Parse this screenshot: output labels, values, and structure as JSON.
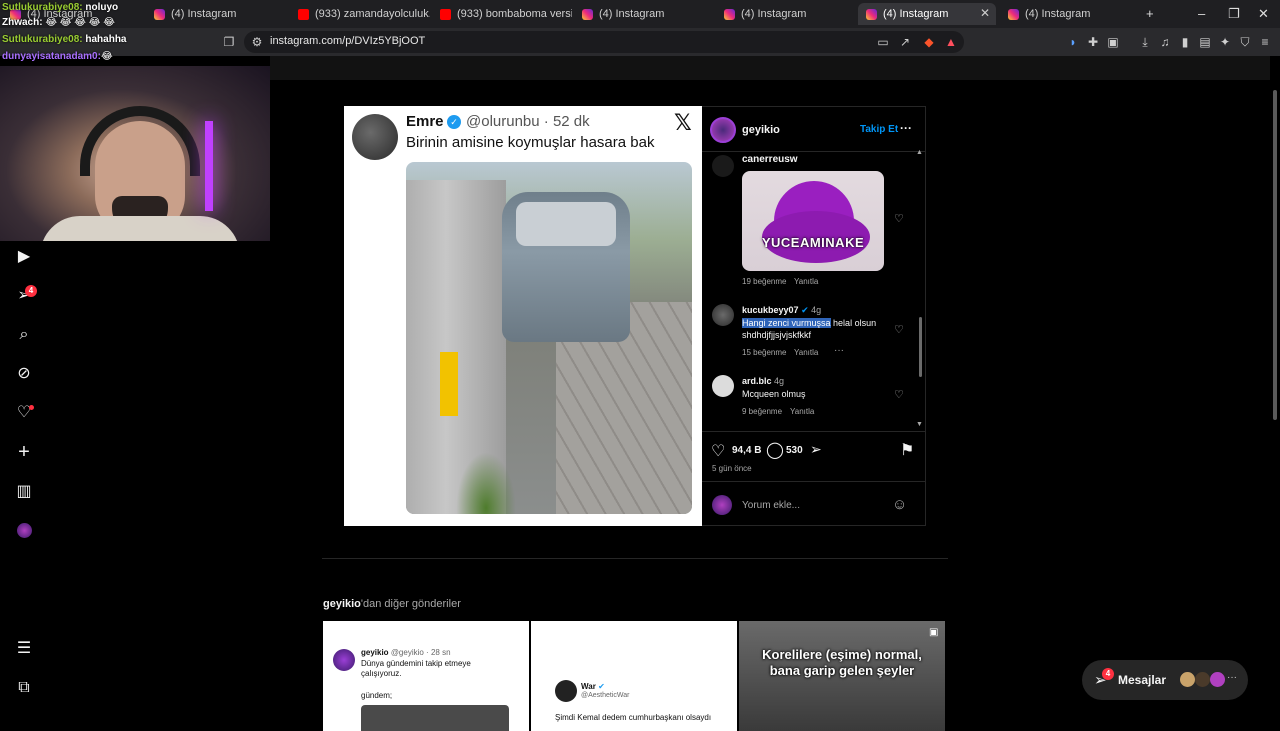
{
  "browser": {
    "tabs": [
      {
        "title": "(4) Instagram",
        "favicon": "instagram",
        "active": false
      },
      {
        "title": "(4) Instagram",
        "favicon": "instagram",
        "active": false
      },
      {
        "title": "(933) zamandayolculuk.mp3 - Y",
        "favicon": "youtube",
        "active": false
      },
      {
        "title": "(933) bombaboma versiyon 2.n",
        "favicon": "youtube",
        "active": false
      },
      {
        "title": "(4) Instagram",
        "favicon": "instagram",
        "active": false
      },
      {
        "title": "(4) Instagram",
        "favicon": "instagram",
        "active": false
      },
      {
        "title": "(4) Instagram",
        "favicon": "instagram",
        "active": true
      },
      {
        "title": "(4) Instagram",
        "favicon": "instagram",
        "active": false
      }
    ],
    "new_tab_symbol": "+",
    "url": "instagram.com/p/DVIz5YBjOOT"
  },
  "stream_chat": [
    {
      "user": "Sutlukurabiye08:",
      "message": "noluyo"
    },
    {
      "user": "Zhwach:",
      "message": "😂 😂 😂 😂 😂"
    },
    {
      "user": "Sutlukurabiye08:",
      "message": "hahahha"
    },
    {
      "user": "dunyayisatanadam0:",
      "message": "😂"
    }
  ],
  "nav": {
    "notifications_badge": "4"
  },
  "post": {
    "tweet": {
      "name": "Emre",
      "handle": "@olurunbu · 52 dk",
      "text": "Birinin amisine koymuşlar hasara bak",
      "x_logo": "𝕏"
    },
    "author": "geyikio",
    "follow_label": "Takip Et",
    "more_symbol": "···",
    "comments": [
      {
        "user": "canerreusw",
        "image_caption": "YUCEAMINAKE",
        "likes": "19 beğenme",
        "reply": "Yanıtla"
      },
      {
        "user": "kucukbeyy07",
        "time": "4g",
        "text_selected": "Hangi zenci vurmuşsa",
        "text_rest": " helal olsun",
        "text_line2": "shdhdjfjjsjvjskfkkf",
        "likes": "15 beğenme",
        "reply": "Yanıtla",
        "more": "···"
      },
      {
        "user": "ard.blc",
        "time": "4g",
        "text": "Mcqueen olmuş",
        "likes": "9 beğenme",
        "reply": "Yanıtla"
      }
    ],
    "like_count": "94,4 B",
    "comment_count": "530",
    "posted": "5 gün önce",
    "comment_placeholder": "Yorum ekle..."
  },
  "more_posts": {
    "title_user": "geyikio",
    "title_rest": "'dan diğer gönderiler",
    "thumbs": [
      {
        "name": "geyikio",
        "handle": "@geyikio · 28 sn",
        "line1": "Dünya gündemini takip etmeye",
        "line2": "çalışıyoruz.",
        "line3": "gündem;"
      },
      {
        "name": "War",
        "handle": "@AestheticWar",
        "line1": "Şimdi Kemal dedem cumhurbaşkanı olsaydı"
      },
      {
        "caption1": "Korelilere (eşime) normal,",
        "caption2": "bana garip gelen şeyler"
      }
    ]
  },
  "messages": {
    "label": "Mesajlar",
    "badge": "4"
  },
  "colors": {
    "accent": "#0095f6",
    "badge": "#ff3040",
    "selection": "#2f64b8"
  }
}
